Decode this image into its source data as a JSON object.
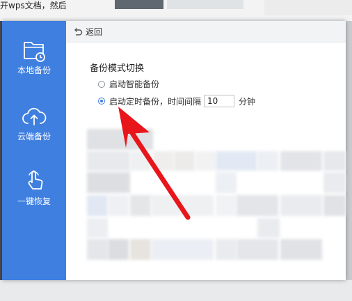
{
  "background": {
    "partial_text": "开wps文档，然后"
  },
  "sidebar": {
    "items": [
      {
        "label": "本地备份",
        "icon": "folder-clock-icon"
      },
      {
        "label": "云端备份",
        "icon": "cloud-upload-icon"
      },
      {
        "label": "一键恢复",
        "icon": "hand-touch-icon"
      }
    ]
  },
  "topbar": {
    "back_label": "返回",
    "back_icon": "undo-arrow-icon"
  },
  "backup_mode": {
    "title": "备份模式切换",
    "options": [
      {
        "label": "启动智能备份",
        "checked": false
      },
      {
        "label": "启动定时备份，时间间隔",
        "checked": true
      }
    ],
    "interval_value": "10",
    "interval_unit": "分钟"
  },
  "colors": {
    "sidebar": "#3f7fe0",
    "accent": "#3f7fe0",
    "annotation_arrow": "#e8161b"
  }
}
